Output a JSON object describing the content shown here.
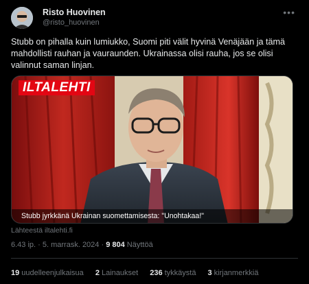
{
  "author": {
    "name": "Risto Huovinen",
    "handle": "@risto_huovinen"
  },
  "more_icon": "more-horizontal-icon",
  "tweet_text": "Stubb on pihalla kuin lumiukko, Suomi piti välit hyvinä Venäjään ja tämä mahdollisti rauhan ja vauraunden. Ukrainassa olisi rauha, jos se olisi valinnut saman linjan.",
  "media": {
    "logo_text": "ILTALEHTI",
    "caption": "Stubb jyrkkänä Ukrainan suomettamisesta: \"Unohtakaa!\""
  },
  "source": "Lähteestä iltalehti.fi",
  "meta": {
    "time": "6.43 ip.",
    "separator": " · ",
    "date": "5. marrask. 2024",
    "views_count": "9 804",
    "views_label": "Näyttöä"
  },
  "stats": [
    {
      "count": "19",
      "label": "uudelleenjulkaisua"
    },
    {
      "count": "2",
      "label": "Lainaukset"
    },
    {
      "count": "236",
      "label": "tykkäystä"
    },
    {
      "count": "3",
      "label": "kirjanmerkkiä"
    }
  ],
  "colors": {
    "background": "#000000",
    "text": "#e7e9ea",
    "muted": "#71767b",
    "logo_red": "#e30613"
  }
}
